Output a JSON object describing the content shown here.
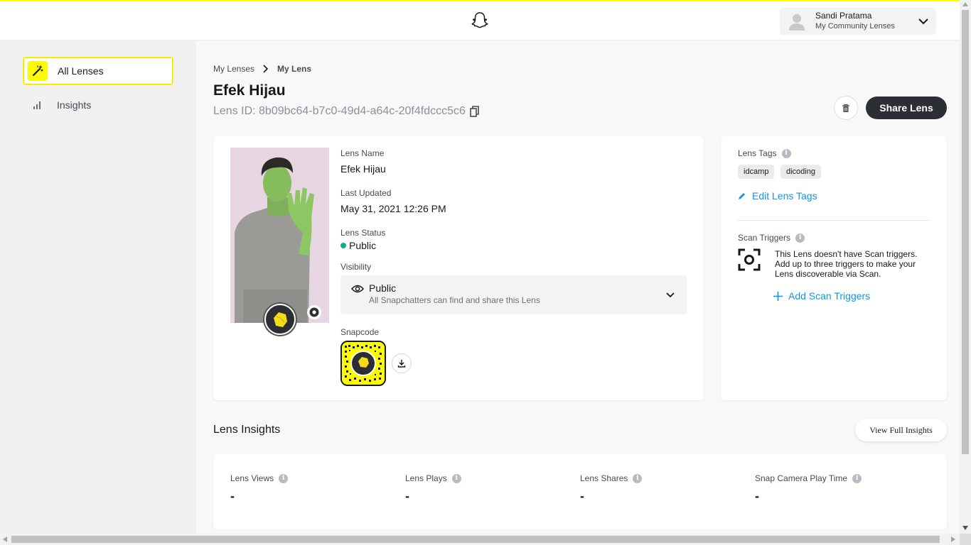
{
  "header": {
    "logo_icon": "snapchat-ghost-icon",
    "user": {
      "name": "Sandi Pratama",
      "subtitle": "My Community Lenses",
      "avatar_icon": "avatar-placeholder-icon",
      "chevron_icon": "chevron-down-icon"
    }
  },
  "sidebar": {
    "items": [
      {
        "label": "All Lenses",
        "icon": "magic-wand-icon",
        "active": true
      },
      {
        "label": "Insights",
        "icon": "bar-chart-icon",
        "active": false
      }
    ]
  },
  "breadcrumb": {
    "parent": "My Lenses",
    "current": "My Lens"
  },
  "page": {
    "title": "Efek Hijau",
    "lens_id": "Lens ID: 8b09bc64-b7c0-49d4-a64c-20f4fdccc5c6",
    "share_label": "Share Lens",
    "delete_icon": "trash-icon",
    "copy_icon": "copy-icon"
  },
  "lens_details": {
    "name_label": "Lens Name",
    "name_value": "Efek Hijau",
    "updated_label": "Last Updated",
    "updated_value": "May 31, 2021 12:26 PM",
    "status_label": "Lens Status",
    "status_value": "Public",
    "status_color": "#0fad8d",
    "visibility_label": "Visibility",
    "visibility_value": "Public",
    "visibility_desc": "All Snapchatters can find and share this Lens",
    "snapcode_label": "Snapcode"
  },
  "side_panel": {
    "tags_label": "Lens Tags",
    "tags": [
      "idcamp",
      "dicoding"
    ],
    "edit_tags_label": "Edit Lens Tags",
    "scan_label": "Scan Triggers",
    "scan_text": "This Lens doesn't have Scan triggers. Add up to three triggers to make your Lens discoverable via Scan.",
    "add_scan_label": "Add Scan Triggers"
  },
  "insights": {
    "title": "Lens Insights",
    "view_full_label": "View Full Insights",
    "metrics": [
      {
        "label": "Lens Views",
        "value": "-"
      },
      {
        "label": "Lens Plays",
        "value": "-"
      },
      {
        "label": "Lens Shares",
        "value": "-"
      },
      {
        "label": "Snap Camera Play Time",
        "value": "-"
      }
    ]
  },
  "colors": {
    "accent": "#fffc00",
    "link": "#0e96e6",
    "dark_button": "#2b2f33"
  }
}
